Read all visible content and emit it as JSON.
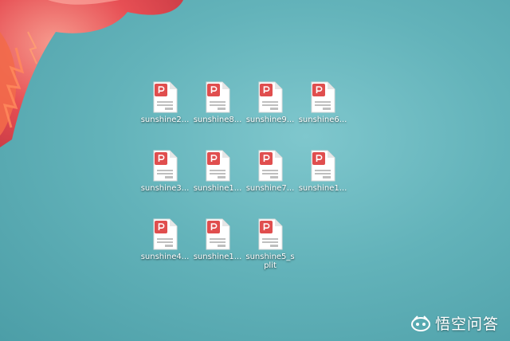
{
  "desktop": {
    "files": [
      {
        "name": "sunshine2...",
        "icon": "pdf-file-icon"
      },
      {
        "name": "sunshine8...",
        "icon": "pdf-file-icon"
      },
      {
        "name": "sunshine9...",
        "icon": "pdf-file-icon"
      },
      {
        "name": "sunshine6...",
        "icon": "pdf-file-icon"
      },
      {
        "name": "sunshine3...",
        "icon": "pdf-file-icon"
      },
      {
        "name": "sunshine1...",
        "icon": "pdf-file-icon"
      },
      {
        "name": "sunshine7...",
        "icon": "pdf-file-icon"
      },
      {
        "name": "sunshine1...",
        "icon": "pdf-file-icon"
      },
      {
        "name": "sunshine4...",
        "icon": "pdf-file-icon"
      },
      {
        "name": "sunshine1...",
        "icon": "pdf-file-icon"
      },
      {
        "name": "sunshine5_split",
        "icon": "pdf-file-icon"
      }
    ]
  },
  "watermark": {
    "text": "悟空问答",
    "icon": "wukong-logo-icon"
  },
  "colors": {
    "pdf_red": "#e04e4e",
    "desktop_teal": "#63b3ba"
  }
}
